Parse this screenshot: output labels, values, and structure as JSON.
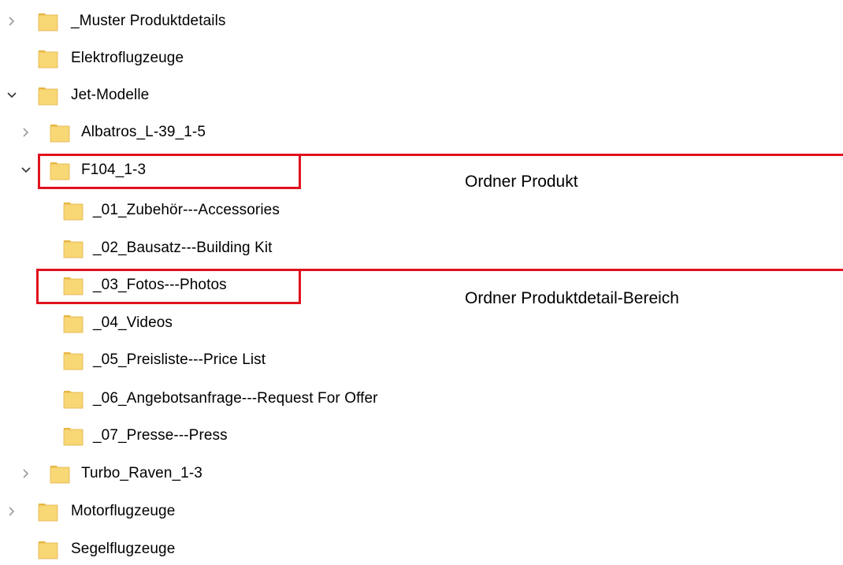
{
  "tree": {
    "items": [
      {
        "label": "_Muster Produktdetails",
        "chevron": "right"
      },
      {
        "label": "Elektroflugzeuge",
        "chevron": "none"
      },
      {
        "label": "Jet-Modelle",
        "chevron": "down"
      },
      {
        "label": "Albatros_L-39_1-5",
        "chevron": "right"
      },
      {
        "label": "F104_1-3",
        "chevron": "down"
      },
      {
        "label": "_01_Zubehör---Accessories",
        "chevron": "none"
      },
      {
        "label": "_02_Bausatz---Building Kit",
        "chevron": "none"
      },
      {
        "label": "_03_Fotos---Photos",
        "chevron": "none"
      },
      {
        "label": "_04_Videos",
        "chevron": "none"
      },
      {
        "label": "_05_Preisliste---Price List",
        "chevron": "none"
      },
      {
        "label": "_06_Angebotsanfrage---Request For Offer",
        "chevron": "none"
      },
      {
        "label": "_07_Presse---Press",
        "chevron": "none"
      },
      {
        "label": "Turbo_Raven_1-3",
        "chevron": "right"
      },
      {
        "label": "Motorflugzeuge",
        "chevron": "right"
      },
      {
        "label": "Segelflugzeuge",
        "chevron": "none"
      }
    ]
  },
  "annotations": {
    "product_folder": "Ordner Produkt",
    "detail_folder": "Ordner Produktdetail-Bereich"
  },
  "colors": {
    "highlight": "#e0121d",
    "folder_body": "#f8d775",
    "folder_tab": "#e8b83f"
  },
  "icons": {
    "folder": "folder-icon",
    "expand": "chevron-right-icon",
    "collapse": "chevron-down-icon"
  }
}
